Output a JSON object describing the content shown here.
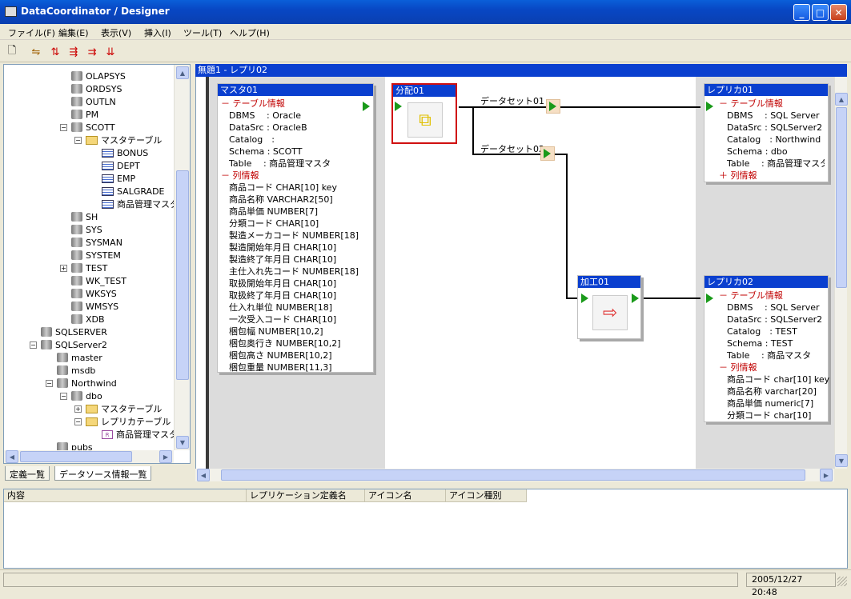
{
  "window": {
    "title": "DataCoordinator / Designer"
  },
  "menu": [
    "ファイル(F)",
    "編集(E)",
    "表示(V)",
    "挿入(I)",
    "ツール(T)",
    "ヘルプ(H)"
  ],
  "tree": [
    {
      "label": "OLAPSYS"
    },
    {
      "label": "ORDSYS"
    },
    {
      "label": "OUTLN"
    },
    {
      "label": "PM"
    },
    {
      "label": "SCOTT"
    },
    {
      "label": "マスタテーブル"
    },
    {
      "label": "BONUS"
    },
    {
      "label": "DEPT"
    },
    {
      "label": "EMP"
    },
    {
      "label": "SALGRADE"
    },
    {
      "label": "商品管理マスタ"
    },
    {
      "label": "SH"
    },
    {
      "label": "SYS"
    },
    {
      "label": "SYSMAN"
    },
    {
      "label": "SYSTEM"
    },
    {
      "label": "TEST"
    },
    {
      "label": "WK_TEST"
    },
    {
      "label": "WKSYS"
    },
    {
      "label": "WMSYS"
    },
    {
      "label": "XDB"
    },
    {
      "label": "SQLSERVER"
    },
    {
      "label": "SQLServer2"
    },
    {
      "label": "master"
    },
    {
      "label": "msdb"
    },
    {
      "label": "Northwind"
    },
    {
      "label": "dbo"
    },
    {
      "label": "マスタテーブル"
    },
    {
      "label": "レプリカテーブル"
    },
    {
      "label": "商品管理マスタ"
    },
    {
      "label": "pubs"
    }
  ],
  "tabs": [
    "定義一覧",
    "データソース情報一覧"
  ],
  "canvas": {
    "title": "無題1 - レプリ02"
  },
  "master": {
    "title": "マスタ01",
    "rows": [
      "－ テーブル情報",
      "DBMS　 : Oracle",
      "DataSrc : OracleB",
      "Catalog　:",
      "Schema : SCOTT",
      "Table　 : 商品管理マスタ",
      "－ 列情報",
      "商品コード CHAR[10] key",
      "商品名称 VARCHAR2[50]",
      "商品単価 NUMBER[7]",
      "分類コード CHAR[10]",
      "製造メーカコード NUMBER[18]",
      "製造開始年月日 CHAR[10]",
      "製造終了年月日 CHAR[10]",
      "主仕入れ先コード NUMBER[18]",
      "取扱開始年月日 CHAR[10]",
      "取扱終了年月日 CHAR[10]",
      "仕入れ単位 NUMBER[18]",
      "一次受入コード CHAR[10]",
      "梱包幅 NUMBER[10,2]",
      "梱包奥行き NUMBER[10,2]",
      "梱包高さ NUMBER[10,2]",
      "梱包重量 NUMBER[11,3]"
    ]
  },
  "distribute": {
    "title": "分配01"
  },
  "process": {
    "title": "加工01"
  },
  "datasets": [
    "データセット01",
    "データセット02"
  ],
  "replica1": {
    "title": "レプリカ01",
    "rows": [
      "－ テーブル情報",
      "DBMS　 : SQL Server",
      "DataSrc : SQLServer2",
      "Catalog　: Northwind",
      "Schema : dbo",
      "Table　 : 商品管理マスタ",
      "＋ 列情報"
    ]
  },
  "replica2": {
    "title": "レプリカ02",
    "rows": [
      "－ テーブル情報",
      "DBMS　 : SQL Server",
      "DataSrc : SQLServer2",
      "Catalog　: TEST",
      "Schema : TEST",
      "Table　 : 商品マスタ",
      "－ 列情報",
      "商品コード char[10] key",
      "商品名称 varchar[20]",
      "商品単価 numeric[7]",
      "分類コード char[10]"
    ]
  },
  "bottom": {
    "columns": [
      "内容",
      "レプリケーション定義名",
      "アイコン名",
      "アイコン種別"
    ]
  },
  "status": {
    "datetime": "2005/12/27 20:48"
  }
}
